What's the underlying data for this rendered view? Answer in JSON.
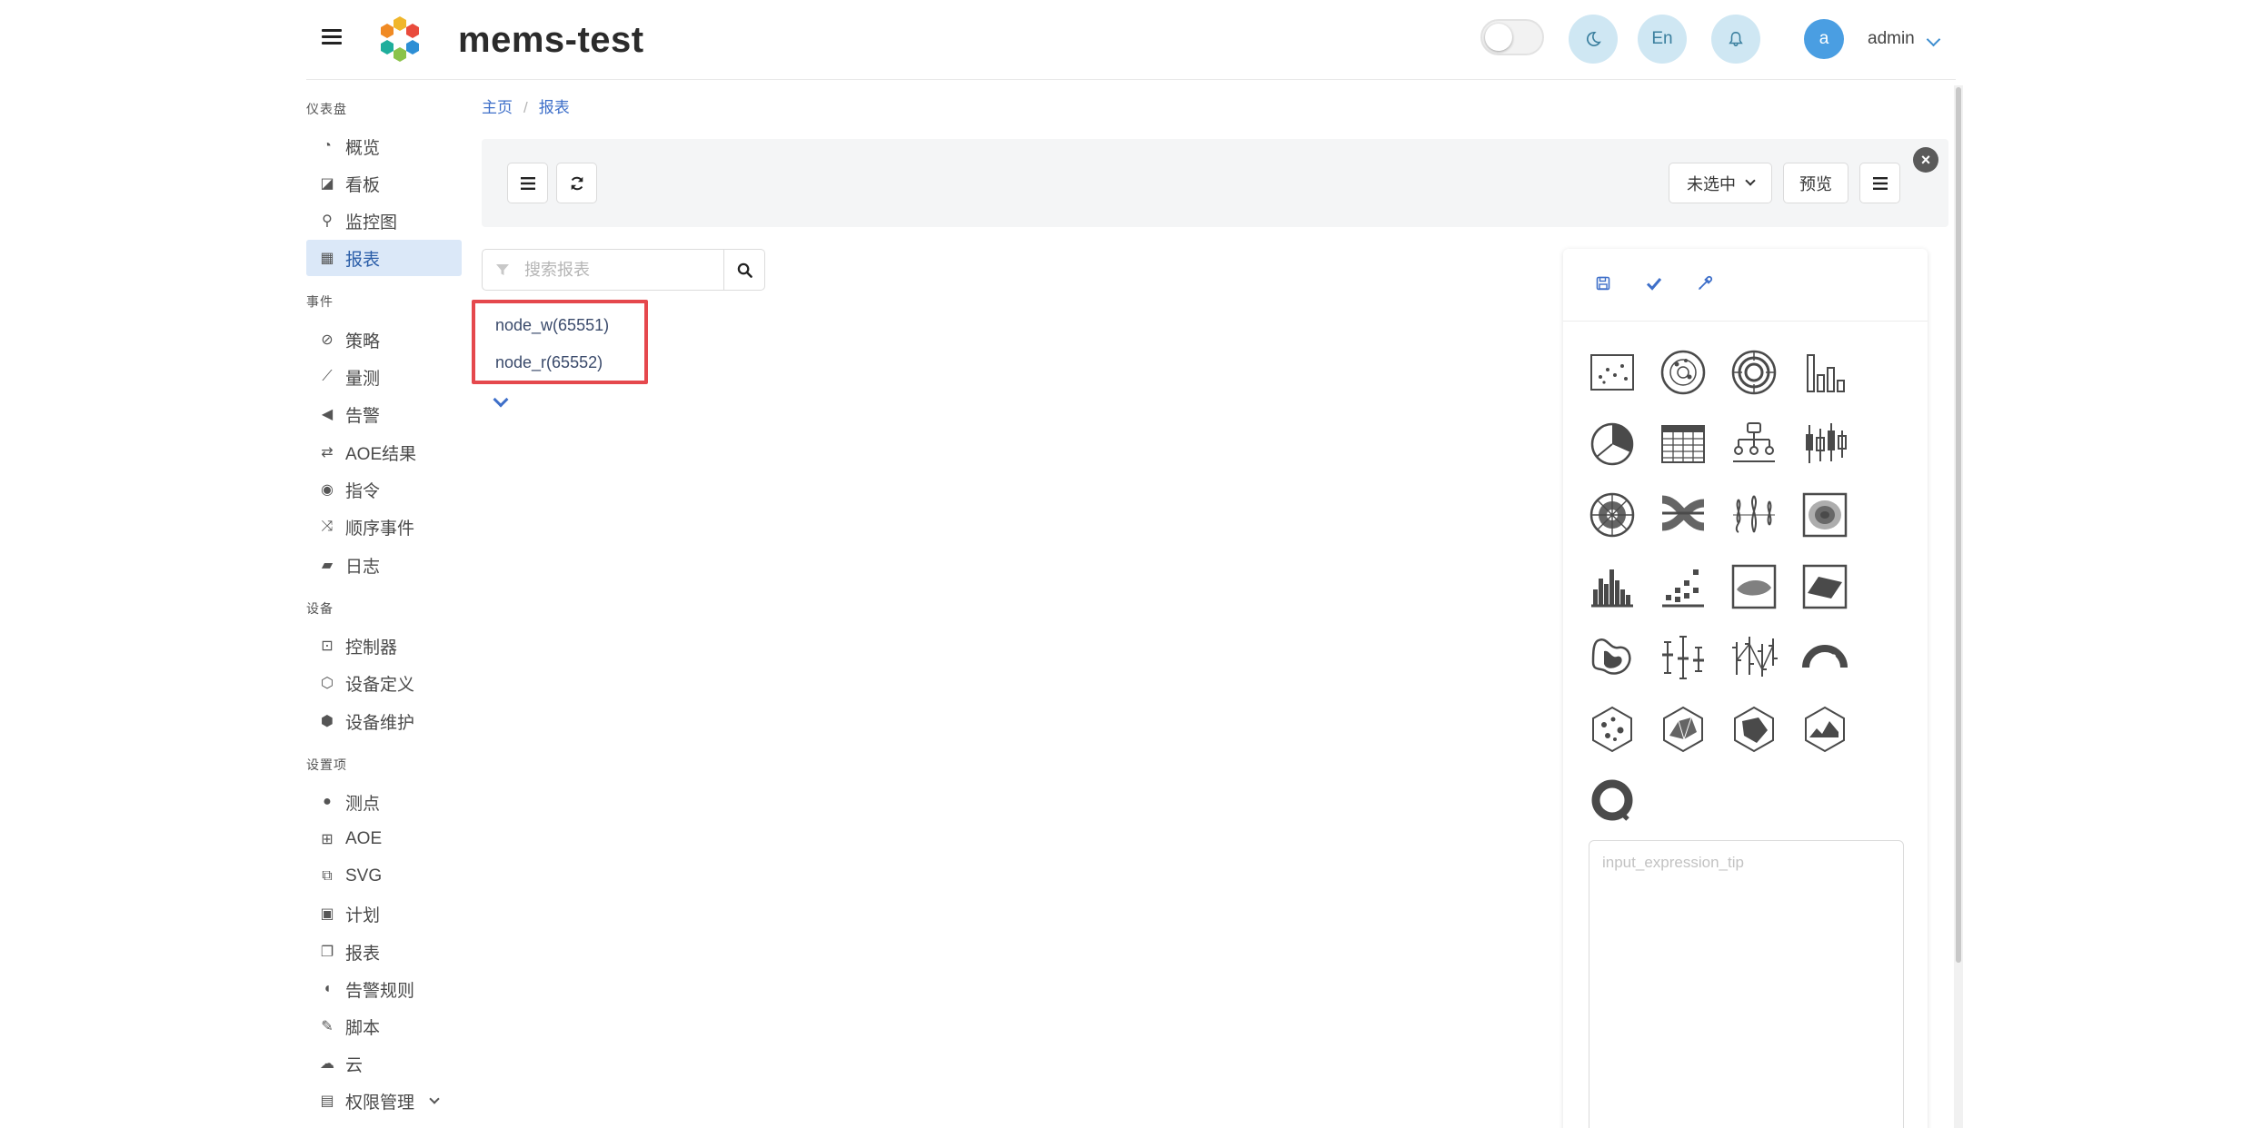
{
  "header": {
    "app_title": "mems-test",
    "theme_button_icon": "moon-icon",
    "language_button_label": "En",
    "notification_icon": "bell-icon",
    "avatar_letter": "a",
    "username": "admin"
  },
  "sidebar": {
    "sections": [
      {
        "label": "仪表盘",
        "items": [
          {
            "label": "概览",
            "icon": "dashboard-icon"
          },
          {
            "label": "看板",
            "icon": "board-icon"
          },
          {
            "label": "监控图",
            "icon": "sitemap-icon"
          },
          {
            "label": "报表",
            "icon": "table-icon",
            "active": true
          }
        ]
      },
      {
        "label": "事件",
        "items": [
          {
            "label": "策略",
            "icon": "compass-icon"
          },
          {
            "label": "量测",
            "icon": "line-chart-icon"
          },
          {
            "label": "告警",
            "icon": "megaphone-icon"
          },
          {
            "label": "AOE结果",
            "icon": "exchange-icon"
          },
          {
            "label": "指令",
            "icon": "broadcast-icon"
          },
          {
            "label": "顺序事件",
            "icon": "shuffle-icon"
          },
          {
            "label": "日志",
            "icon": "book-icon"
          }
        ]
      },
      {
        "label": "设备",
        "items": [
          {
            "label": "控制器",
            "icon": "controller-icon"
          },
          {
            "label": "设备定义",
            "icon": "cube-icon"
          },
          {
            "label": "设备维护",
            "icon": "cubes-icon"
          }
        ]
      },
      {
        "label": "设置项",
        "items": [
          {
            "label": "测点",
            "icon": "pin-icon"
          },
          {
            "label": "AOE",
            "icon": "diagram-icon"
          },
          {
            "label": "SVG",
            "icon": "clone-icon"
          },
          {
            "label": "计划",
            "icon": "calendar-check-icon"
          },
          {
            "label": "报表",
            "icon": "copy-icon"
          },
          {
            "label": "告警规则",
            "icon": "shield-icon"
          },
          {
            "label": "脚本",
            "icon": "plug-icon"
          },
          {
            "label": "云",
            "icon": "cloud-icon"
          },
          {
            "label": "权限管理",
            "icon": "id-card-icon",
            "has_dropdown": true
          }
        ]
      }
    ]
  },
  "breadcrumb": {
    "home": "主页",
    "current": "报表"
  },
  "toolbar": {
    "menu_icon": "list-icon",
    "refresh_icon": "refresh-icon",
    "select_label": "未选中",
    "preview_label": "预览",
    "more_icon": "list-icon",
    "close_icon": "close-icon"
  },
  "search": {
    "placeholder": "搜索报表"
  },
  "reports": [
    {
      "label": "node_w(65551)"
    },
    {
      "label": "node_r(65552)"
    }
  ],
  "panel": {
    "tools": [
      "save-icon",
      "check-icon",
      "eyedropper-icon"
    ],
    "chart_types": [
      "scatter",
      "polar-scatter",
      "radial-bar",
      "bar",
      "pie",
      "table",
      "tree",
      "candlestick",
      "sunburst-radar",
      "sankey",
      "violin",
      "contour",
      "histogram",
      "heatmap-bars",
      "density",
      "surface",
      "blob",
      "error-bars",
      "ohlc",
      "gauge",
      "hex-scatter",
      "hex-mesh",
      "hex-polygon",
      "hex-area",
      "ring"
    ],
    "expression_placeholder": "input_expression_tip"
  },
  "colors": {
    "accent": "#3e6fc9",
    "active_bg": "#dbe8f8",
    "highlight_border": "#e5484d",
    "round_button": "#cfe7f3"
  }
}
